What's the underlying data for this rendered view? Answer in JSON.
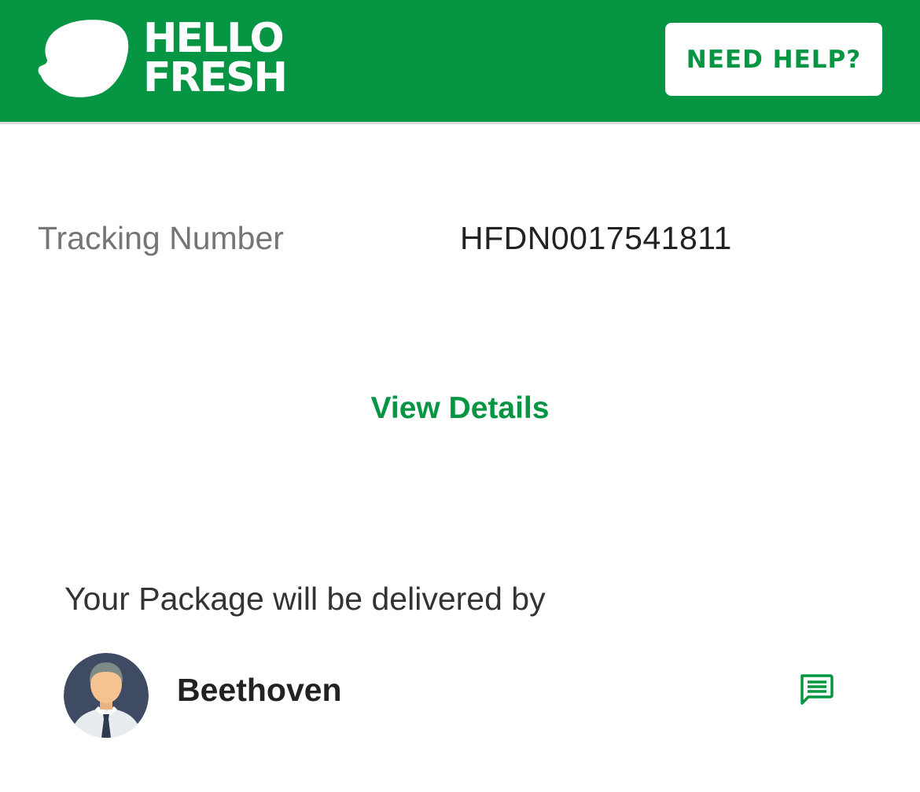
{
  "header": {
    "brand_line1": "HELLO",
    "brand_line2": "FRESH",
    "help_button_label": "NEED HELP?",
    "brand_color": "#069543",
    "logo_icon": "lemon-icon"
  },
  "tracking": {
    "label": "Tracking Number",
    "value": "HFDN0017541811"
  },
  "details_link": "View Details",
  "delivery": {
    "intro": "Your Package will be delivered by",
    "driver_name": "Beethoven",
    "avatar_icon": "driver-avatar",
    "message_icon": "chat-message-icon"
  }
}
